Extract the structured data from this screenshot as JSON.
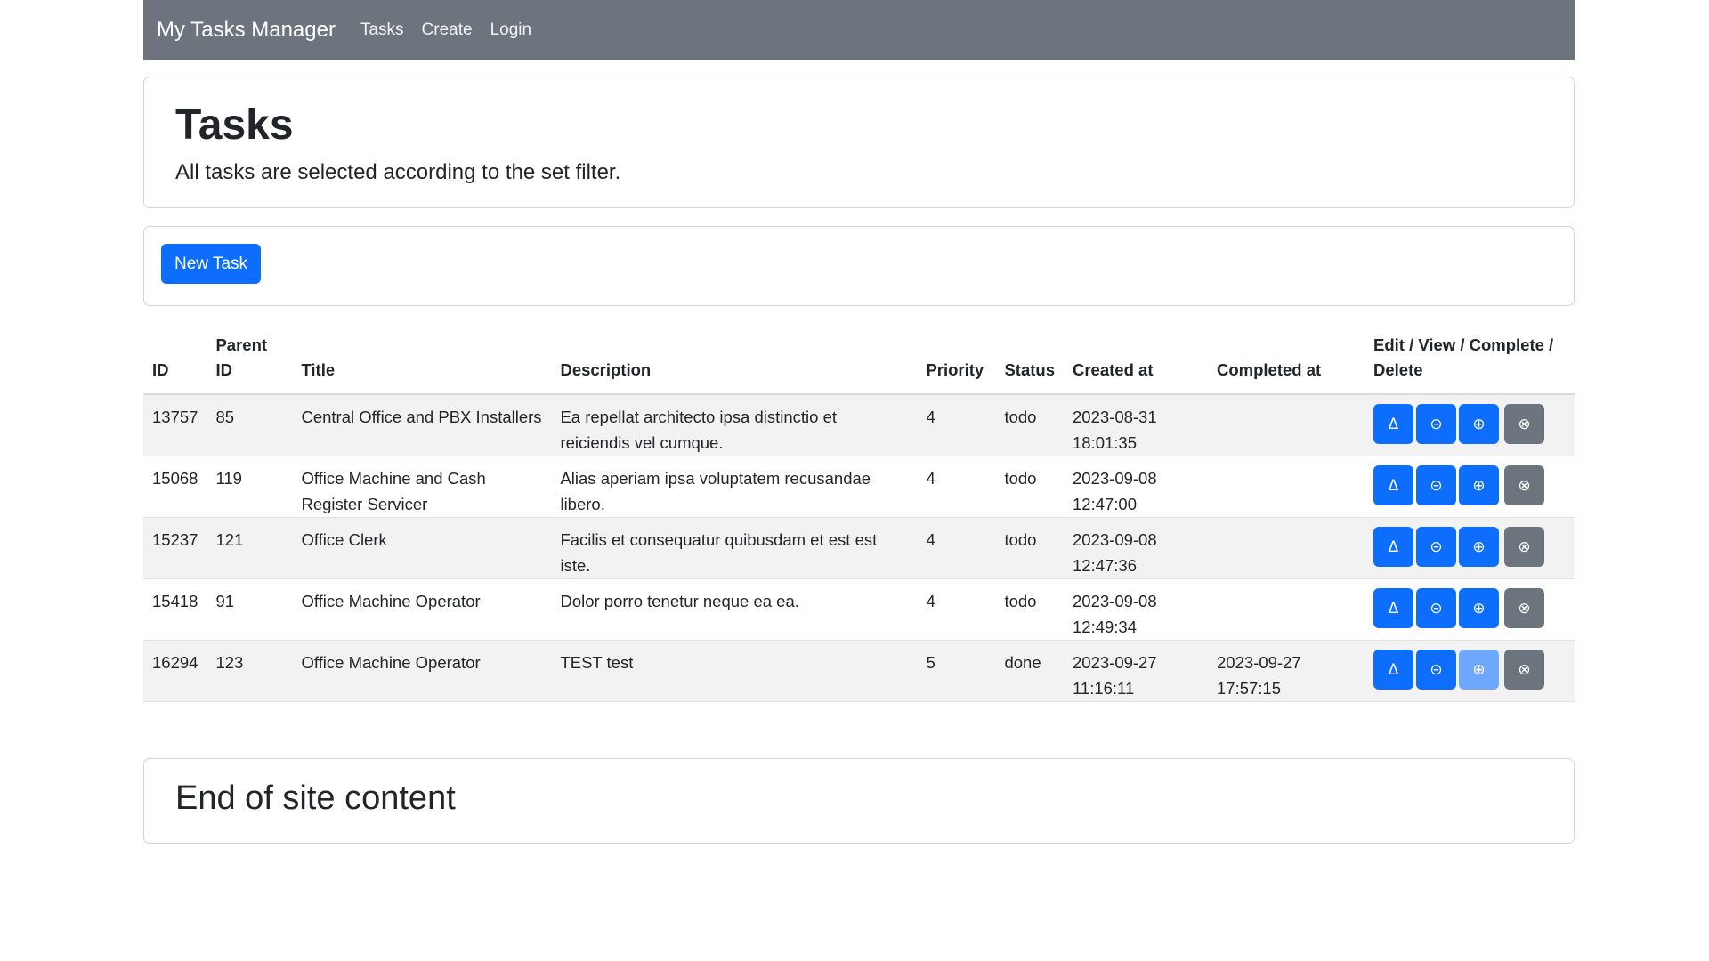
{
  "navbar": {
    "brand": "My Tasks Manager",
    "links": [
      "Tasks",
      "Create",
      "Login"
    ]
  },
  "header": {
    "title": "Tasks",
    "subtitle": "All tasks are selected according to the set filter."
  },
  "actions": {
    "new_task_label": "New Task"
  },
  "table": {
    "headers": {
      "id": "ID",
      "parent_id": "Parent ID",
      "title": "Title",
      "description": "Description",
      "priority": "Priority",
      "status": "Status",
      "created_at": "Created at",
      "completed_at": "Completed at",
      "actions": "Edit / View / Complete / Delete"
    },
    "action_icons": {
      "edit": "Δ",
      "view": "⊝",
      "complete": "⊕",
      "delete": "⊗"
    },
    "rows": [
      {
        "id": "13757",
        "parent_id": "85",
        "title": "Central Office and PBX Installers",
        "description": "Ea repellat architecto ipsa distinctio et reiciendis vel cumque.",
        "priority": "4",
        "status": "todo",
        "created_at": "2023-08-31 18:01:35",
        "completed_at": "",
        "complete_enabled": true
      },
      {
        "id": "15068",
        "parent_id": "119",
        "title": "Office Machine and Cash Register Servicer",
        "description": "Alias aperiam ipsa voluptatem recusandae libero.",
        "priority": "4",
        "status": "todo",
        "created_at": "2023-09-08 12:47:00",
        "completed_at": "",
        "complete_enabled": true
      },
      {
        "id": "15237",
        "parent_id": "121",
        "title": "Office Clerk",
        "description": "Facilis et consequatur quibusdam et est est iste.",
        "priority": "4",
        "status": "todo",
        "created_at": "2023-09-08 12:47:36",
        "completed_at": "",
        "complete_enabled": true
      },
      {
        "id": "15418",
        "parent_id": "91",
        "title": "Office Machine Operator",
        "description": "Dolor porro tenetur neque ea ea.",
        "priority": "4",
        "status": "todo",
        "created_at": "2023-09-08 12:49:34",
        "completed_at": "",
        "complete_enabled": true
      },
      {
        "id": "16294",
        "parent_id": "123",
        "title": "Office Machine Operator",
        "description": "TEST test",
        "priority": "5",
        "status": "done",
        "created_at": "2023-09-27 11:16:11",
        "completed_at": "2023-09-27 17:57:15",
        "complete_enabled": false
      }
    ]
  },
  "footer": {
    "title": "End of site content"
  },
  "colors": {
    "navbar_bg": "#6c757d",
    "primary": "#0d6efd",
    "primary_disabled": "#6ea8fe",
    "secondary": "#6c757d",
    "row_stripe": "#f2f2f2"
  }
}
